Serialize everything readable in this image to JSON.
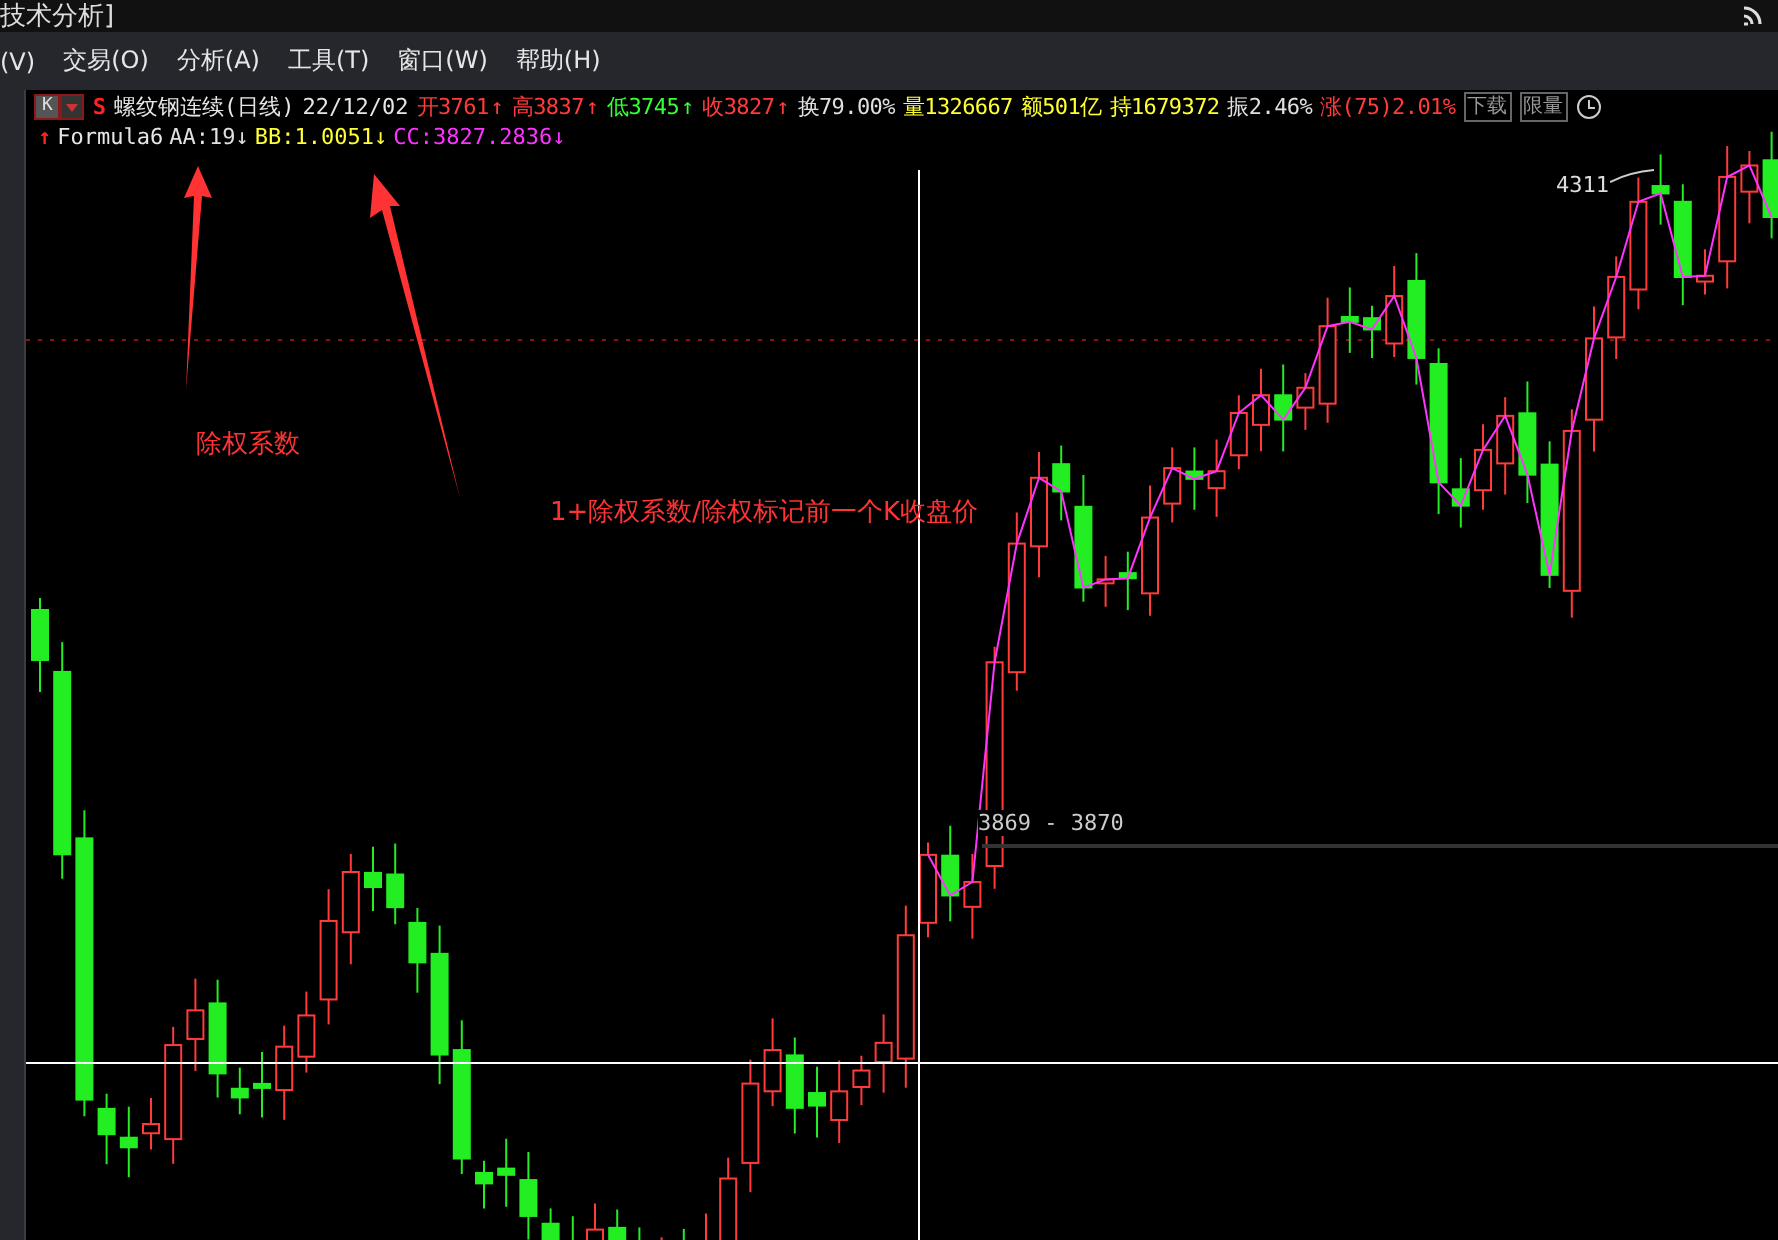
{
  "title_bar": {
    "title": "技术分析]"
  },
  "menu": [
    {
      "label": "(V)"
    },
    {
      "label": "交易(O)"
    },
    {
      "label": "分析(A)"
    },
    {
      "label": "工具(T)"
    },
    {
      "label": "窗口(W)"
    },
    {
      "label": "帮助(H)"
    }
  ],
  "quote_header": {
    "period_button": "K",
    "marker": "S",
    "name": "螺纹钢连续(日线)",
    "date": "22/12/02",
    "fields": [
      {
        "label": "开3761",
        "arrow": "↑",
        "color": "#ff3b3b"
      },
      {
        "label": "高3837",
        "arrow": "↑",
        "color": "#ff3b3b"
      },
      {
        "label": "低3745",
        "arrow": "↑",
        "color": "#33ff33"
      },
      {
        "label": "收3827",
        "arrow": "↑",
        "color": "#ff3b3b"
      },
      {
        "label": "换79.00%",
        "color": "#e0e0e0"
      },
      {
        "label": "量1326667",
        "color": "#ffff33"
      },
      {
        "label": "额501亿",
        "color": "#ffff33"
      },
      {
        "label": "持1679372",
        "color": "#ffff33"
      },
      {
        "label": "振2.46%",
        "color": "#e0e0e0"
      },
      {
        "label": "涨(75)2.01%",
        "color": "#ff3b3b"
      }
    ],
    "buttons": [
      "下载",
      "限量"
    ]
  },
  "indicator": {
    "marker": "↑",
    "name": "Formula6",
    "values": [
      {
        "text": "AA:19",
        "arrow": "↓",
        "color": "#e0e0e0"
      },
      {
        "text": "BB:1.0051",
        "arrow": "↓",
        "color": "#ffff33"
      },
      {
        "text": "CC:3827.2836",
        "arrow": "↓",
        "color": "#ff33ff"
      }
    ]
  },
  "annotations": [
    {
      "text": "除权系数"
    },
    {
      "text": "1+除权系数/除权标记前一个K收盘价"
    }
  ],
  "chart": {
    "peak_label": "4311",
    "crosshair_label": "3869 - 3870"
  }
}
